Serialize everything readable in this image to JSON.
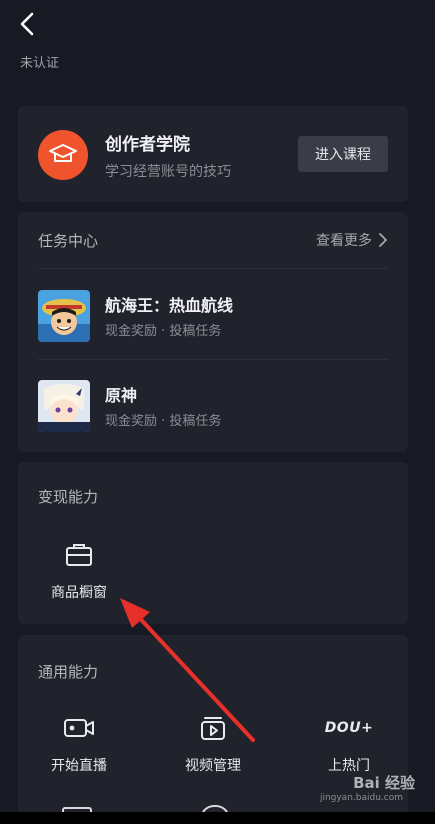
{
  "header": {
    "status": "未认证"
  },
  "academy": {
    "title": "创作者学院",
    "subtitle": "学习经营账号的技巧",
    "button": "进入课程"
  },
  "tasks": {
    "title": "任务中心",
    "see_more": "查看更多",
    "items": [
      {
        "title": "航海王：热血航线",
        "subtitle": "现金奖励 · 投稿任务"
      },
      {
        "title": "原神",
        "subtitle": "现金奖励 · 投稿任务"
      }
    ]
  },
  "monetize": {
    "title": "变现能力",
    "items": [
      {
        "label": "商品橱窗",
        "icon": "shop-window-icon"
      }
    ]
  },
  "general": {
    "title": "通用能力",
    "items": [
      {
        "label": "开始直播",
        "icon": "live-camera-icon"
      },
      {
        "label": "视频管理",
        "icon": "video-manage-icon"
      },
      {
        "label": "上热门",
        "icon": "dou-plus-icon",
        "logo_text": "DOU+"
      }
    ]
  },
  "watermark": {
    "text": "Bai 经验",
    "sub": "jingyan.baidu.com"
  },
  "colors": {
    "accent": "#f0542d",
    "arrow": "#e8302a",
    "background": "#171923",
    "card": "#20222c"
  }
}
